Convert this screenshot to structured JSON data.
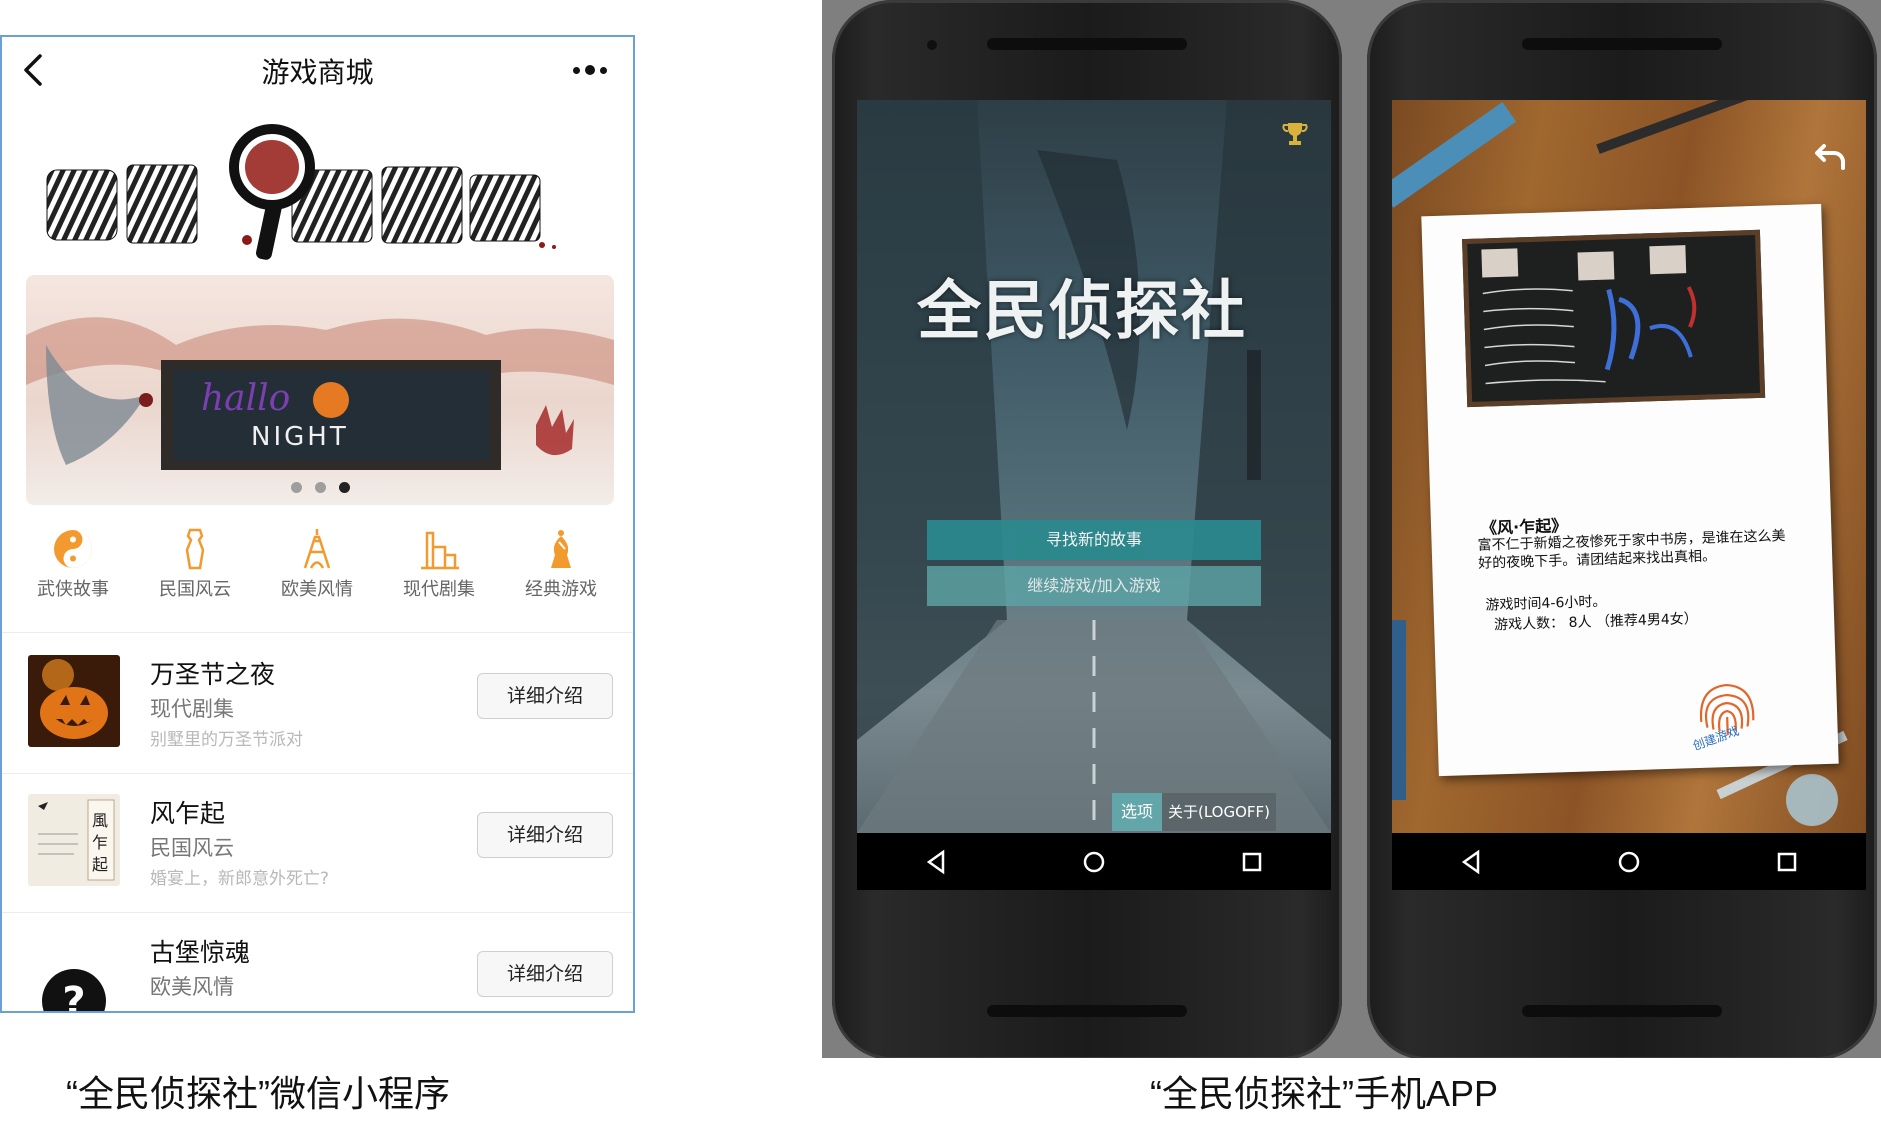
{
  "wechat": {
    "title": "游戏商城",
    "back_icon": "chevron-left-icon",
    "more_icon": "more-dots-icon",
    "banner": {
      "page_count": 3,
      "active_index": 2
    },
    "categories": [
      {
        "label": "武侠故事",
        "icon": "yin-yang-icon"
      },
      {
        "label": "民国风云",
        "icon": "qipao-dress-icon"
      },
      {
        "label": "欧美风情",
        "icon": "eiffel-tower-icon"
      },
      {
        "label": "现代剧集",
        "icon": "city-building-icon"
      },
      {
        "label": "经典游戏",
        "icon": "bishop-piece-icon"
      }
    ],
    "games": [
      {
        "name": "万圣节之夜",
        "category": "现代剧集",
        "desc": "别墅里的万圣节派对",
        "button": "详细介绍"
      },
      {
        "name": "风乍起",
        "category": "民国风云",
        "desc": "婚宴上，新郎意外死亡?",
        "button": "详细介绍"
      },
      {
        "name": "古堡惊魂",
        "category": "欧美风情",
        "desc": "",
        "button": "详细介绍"
      }
    ],
    "accent_color": "#f39a2e"
  },
  "app": {
    "main_screen": {
      "title": "全民侦探社",
      "new_story_button": "寻找新的故事",
      "continue_button": "继续游戏/加入游戏",
      "options_button": "选项",
      "about_button": "关于(LOGOFF)",
      "trophy_icon": "trophy-icon",
      "accent_color": "#2a8a8e"
    },
    "story_screen": {
      "back_icon": "undo-arrow-icon",
      "story_title": "《风·乍起》",
      "story_text": "富不仁于新婚之夜惨死于家中书房，是谁在这么美好的夜晚下手。请团结起来找出真相。",
      "play_time": "游戏时间4-6小时。",
      "players": "游戏人数：  8人  （推荐4男4女）",
      "create_button": "创建游戏",
      "fingerprint_icon": "fingerprint-icon"
    }
  },
  "captions": {
    "left": "“全民侦探社”微信小程序",
    "right": "“全民侦探社”手机APP"
  }
}
